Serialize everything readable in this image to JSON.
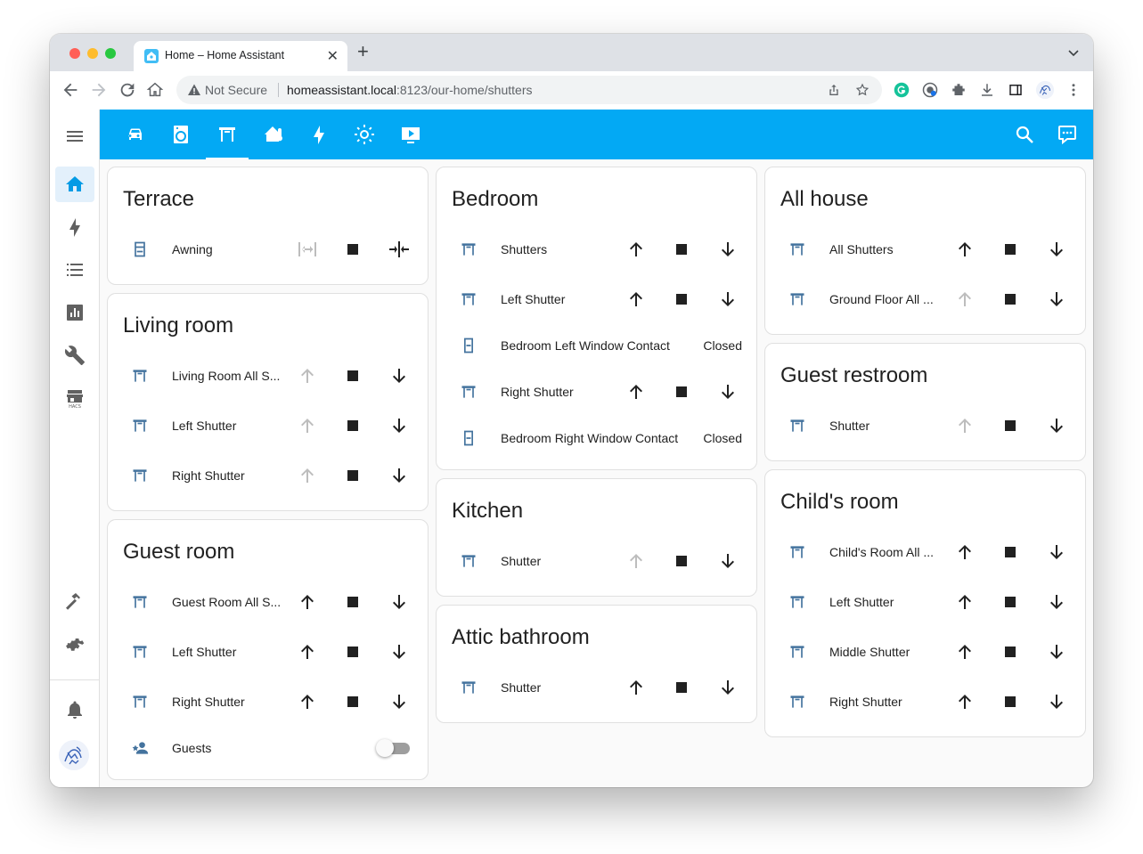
{
  "browser": {
    "tab_title": "Home – Home Assistant",
    "not_secure": "Not Secure",
    "url_host": "homeassistant.local",
    "url_path": ":8123/our-home/shutters"
  },
  "colors": {
    "accent": "#03a9f4",
    "cover_icon": "#44739e",
    "disabled": "#bdbdbd",
    "text": "#212121"
  },
  "header": {
    "views": [
      "car-icon",
      "washing-machine-icon",
      "window-shutter-icon",
      "home-thermometer-icon",
      "flash-icon",
      "weather-sunny-icon",
      "television-play-icon"
    ],
    "active_view": 2
  },
  "cards": {
    "terrace": {
      "title": "Terrace",
      "rows": [
        {
          "name": "Awning"
        }
      ]
    },
    "living_room": {
      "title": "Living room",
      "rows": [
        {
          "name": "Living Room All S...",
          "up_disabled": true
        },
        {
          "name": "Left Shutter",
          "up_disabled": true
        },
        {
          "name": "Right Shutter",
          "up_disabled": true
        }
      ]
    },
    "guest_room": {
      "title": "Guest room",
      "rows": [
        {
          "name": "Guest Room All S..."
        },
        {
          "name": "Left Shutter"
        },
        {
          "name": "Right Shutter"
        }
      ],
      "guests": {
        "name": "Guests",
        "on": false
      }
    },
    "bedroom": {
      "title": "Bedroom",
      "rows": [
        {
          "name": "Shutters"
        },
        {
          "name": "Left Shutter"
        },
        {
          "name": "Bedroom Left Window Contact",
          "state": "Closed"
        },
        {
          "name": "Right Shutter"
        },
        {
          "name": "Bedroom Right Window Contact",
          "state": "Closed"
        }
      ]
    },
    "kitchen": {
      "title": "Kitchen",
      "rows": [
        {
          "name": "Shutter",
          "up_disabled": true
        }
      ]
    },
    "attic_bathroom": {
      "title": "Attic bathroom",
      "rows": [
        {
          "name": "Shutter"
        }
      ]
    },
    "all_house": {
      "title": "All house",
      "rows": [
        {
          "name": "All Shutters"
        },
        {
          "name": "Ground Floor All ...",
          "up_disabled": true
        }
      ]
    },
    "guest_restroom": {
      "title": "Guest restroom",
      "rows": [
        {
          "name": "Shutter",
          "up_disabled": true
        }
      ]
    },
    "childs_room": {
      "title": "Child's room",
      "rows": [
        {
          "name": "Child's Room All ..."
        },
        {
          "name": "Left Shutter"
        },
        {
          "name": "Middle Shutter"
        },
        {
          "name": "Right Shutter"
        }
      ]
    }
  }
}
